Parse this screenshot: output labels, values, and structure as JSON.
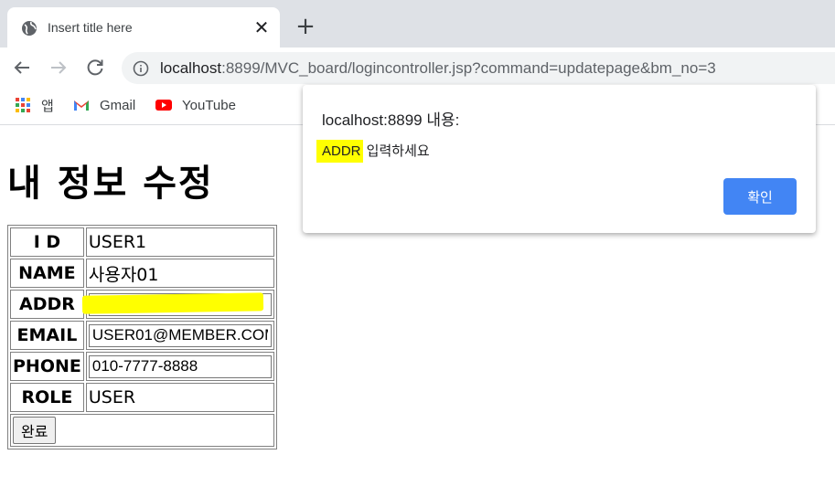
{
  "browser": {
    "tab_title": "Insert title here",
    "tab_close": "✕",
    "new_tab": "+",
    "url_host": "localhost",
    "url_rest": ":8899/MVC_board/logincontroller.jsp?command=updatepage&bm_no=3"
  },
  "bookmarks": [
    {
      "label": "앱",
      "icon": "apps-grid-icon"
    },
    {
      "label": "Gmail",
      "icon": "gmail-icon"
    },
    {
      "label": "YouTube",
      "icon": "youtube-icon"
    }
  ],
  "page": {
    "title": "내 정보 수정",
    "rows": {
      "id": {
        "label": "I D",
        "value": "USER1"
      },
      "name": {
        "label": "NAME",
        "value": "사용자01"
      },
      "addr": {
        "label": "ADDR",
        "value": ""
      },
      "email": {
        "label": "EMAIL",
        "value": "USER01@MEMBER.COM"
      },
      "phone": {
        "label": "PHONE",
        "value": "010-7777-8888"
      },
      "role": {
        "label": "ROLE",
        "value": "USER"
      }
    },
    "submit_label": "완료"
  },
  "dialog": {
    "title": "localhost:8899 내용:",
    "message_highlight": "ADDR",
    "message_rest": " 입력하세요",
    "ok_label": "확인"
  },
  "colors": {
    "highlight": "#ffff00",
    "dialog_button": "#4285f4"
  }
}
